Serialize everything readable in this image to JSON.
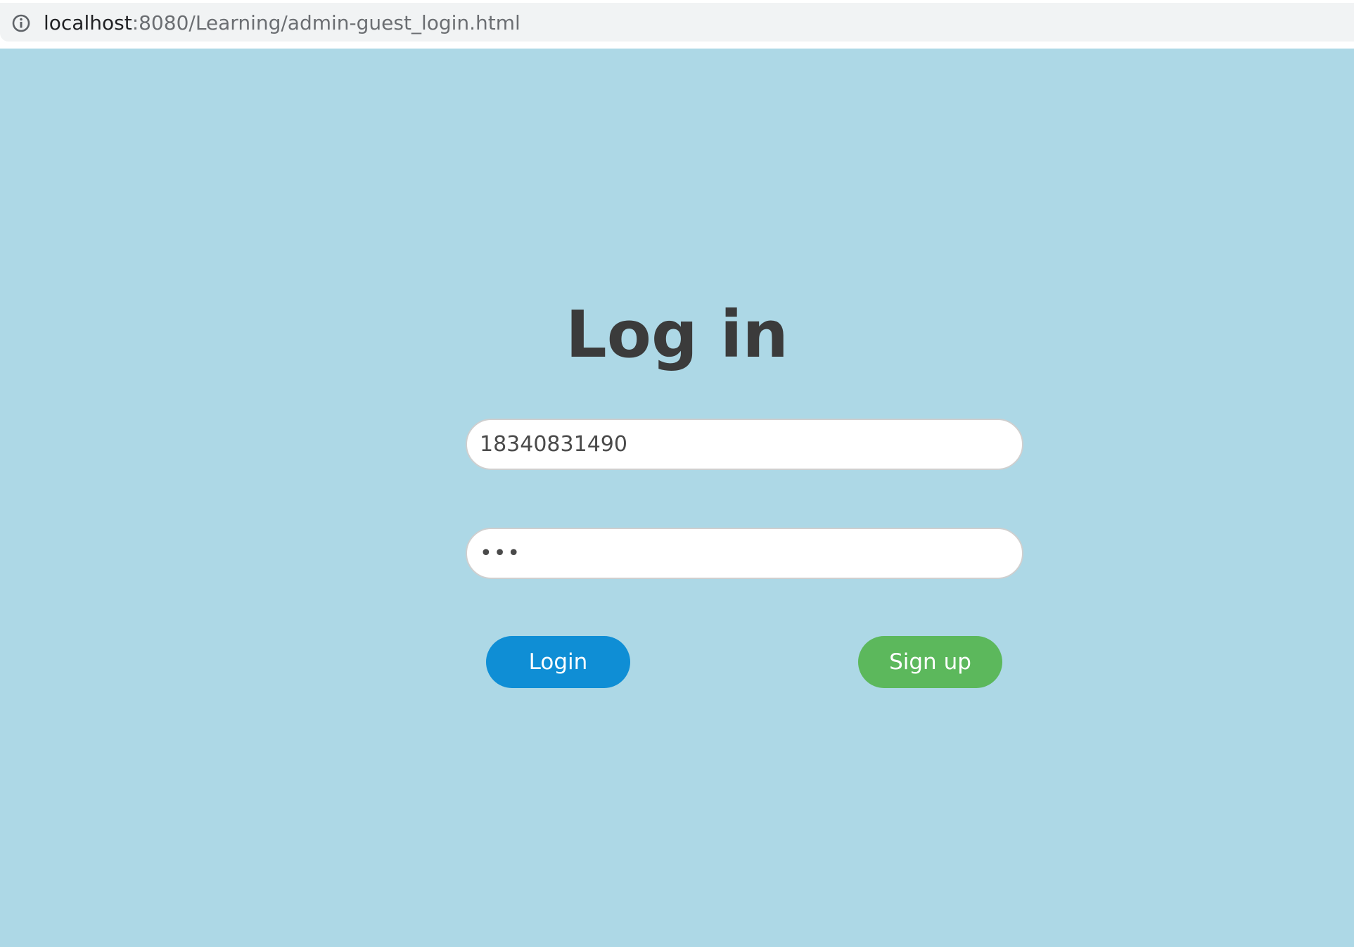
{
  "browser": {
    "url_host": "localhost",
    "url_path": ":8080/Learning/admin-guest_login.html",
    "info_icon": "info-icon"
  },
  "login": {
    "title": "Log in",
    "username_value": "18340831490",
    "password_value": "•••",
    "login_label": "Login",
    "signup_label": "Sign up"
  },
  "colors": {
    "page_background": "#add8e6",
    "title_color": "#3b3b3b",
    "login_button": "#0f8ed5",
    "signup_button": "#5cb85c",
    "address_bar": "#f1f3f4"
  }
}
